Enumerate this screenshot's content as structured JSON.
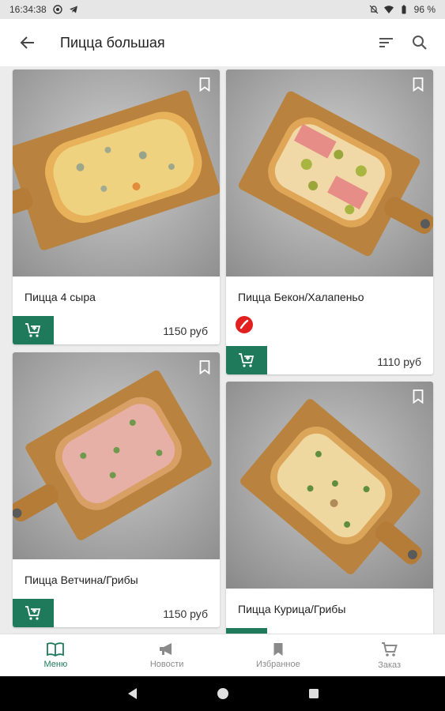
{
  "status": {
    "time": "16:34:38",
    "battery": "96 %"
  },
  "appbar": {
    "title": "Пицца большая"
  },
  "products": [
    {
      "name": "Пицца 4 сыра",
      "price": "1150 руб"
    },
    {
      "name": "Пицца Бекон/Халапеньо",
      "price": "1110 руб",
      "spicy_badge": "chili-icon"
    },
    {
      "name": "Пицца Ветчина/Грибы",
      "price": "1150 руб"
    },
    {
      "name": "Пицца Курица/Грибы"
    }
  ],
  "nav": {
    "items": [
      {
        "label": "Меню",
        "icon": "book-icon"
      },
      {
        "label": "Новости",
        "icon": "megaphone-icon"
      },
      {
        "label": "Избранное",
        "icon": "bookmark-icon"
      },
      {
        "label": "Заказ",
        "icon": "cart-icon"
      }
    ]
  },
  "colors": {
    "accent": "#1f7a5c",
    "chili": "#e32020"
  }
}
